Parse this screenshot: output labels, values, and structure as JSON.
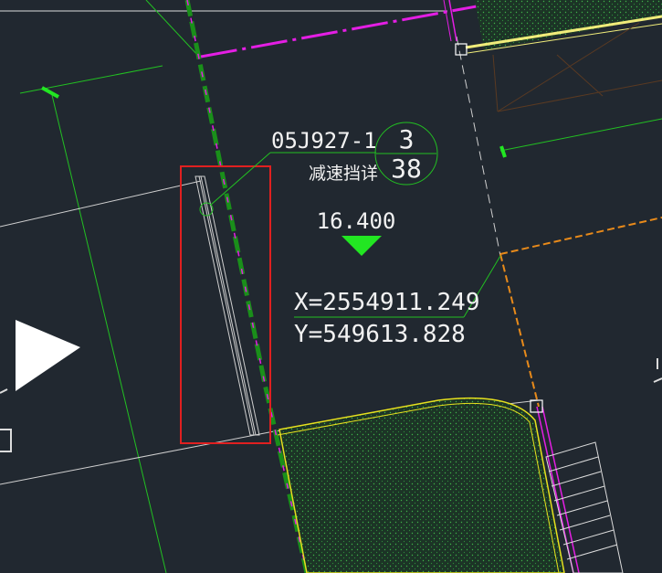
{
  "annotation": {
    "detail_ref": "05J927-1",
    "detail_desc": "减速挡详",
    "bubble_top": "3",
    "bubble_bottom": "38"
  },
  "elevation": {
    "value": "16.400"
  },
  "coordinates": {
    "x": "X=2554911.249",
    "y": "Y=549613.828"
  },
  "colors": {
    "background": "#212830",
    "road_magenta": "#e41ee4",
    "boundary_green": "#22c022",
    "dash_green": "#1a8f1a",
    "leader_green": "#22c022",
    "elevation_marker": "#22e622",
    "linework_white": "#dcdcdc",
    "dash_orange": "#e88a1a",
    "highlight_yellow": "#e6e01e",
    "selection_red": "#e02020",
    "hatch_fill": "#1f3a2a"
  },
  "icons": [
    "direction-arrow-icon",
    "elevation-triangle-icon",
    "grip-square-icon"
  ]
}
